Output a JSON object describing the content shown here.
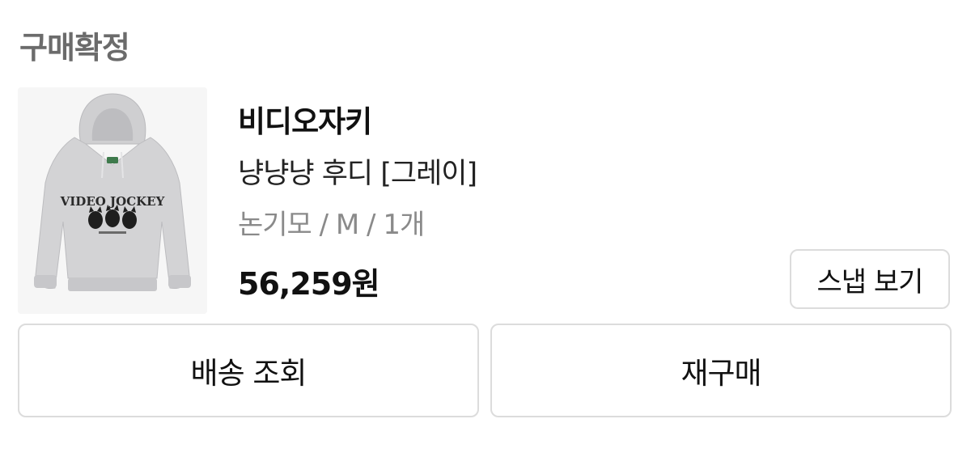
{
  "order": {
    "status": "구매확정"
  },
  "product": {
    "brand": "비디오자키",
    "name": "냥냥냥 후디 [그레이]",
    "option": "논기모 / M / 1개",
    "price": "56,259원",
    "image_icon": "hoodie-product-image",
    "image_print_text": "VIDEO JOCKEY"
  },
  "buttons": {
    "snap": "스냅 보기",
    "shipping": "배송 조회",
    "reorder": "재구매"
  },
  "colors": {
    "status_text": "#6b6b6b",
    "border": "#dcdcdc",
    "option_text": "#8a8a8a"
  }
}
